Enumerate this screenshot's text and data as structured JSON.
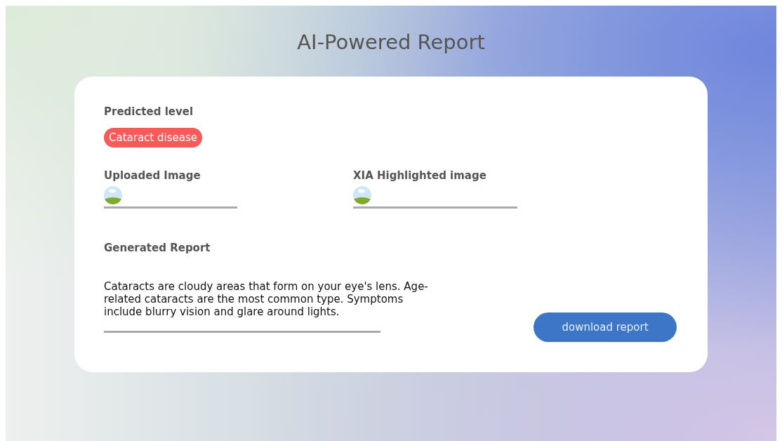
{
  "title": "AI-Powered Report",
  "prediction": {
    "label": "Predicted level",
    "badge": "Cataract disease",
    "color": "#f85a5a"
  },
  "images": [
    {
      "label": "Uploaded Image"
    },
    {
      "label": "XIA Highlighted image"
    }
  ],
  "report": {
    "label": "Generated Report",
    "text": "Cataracts are cloudy areas that form on your eye's lens. Age-related cataracts are the most common type. Symptoms include blurry vision and glare around lights."
  },
  "buttons": [
    "download report"
  ]
}
